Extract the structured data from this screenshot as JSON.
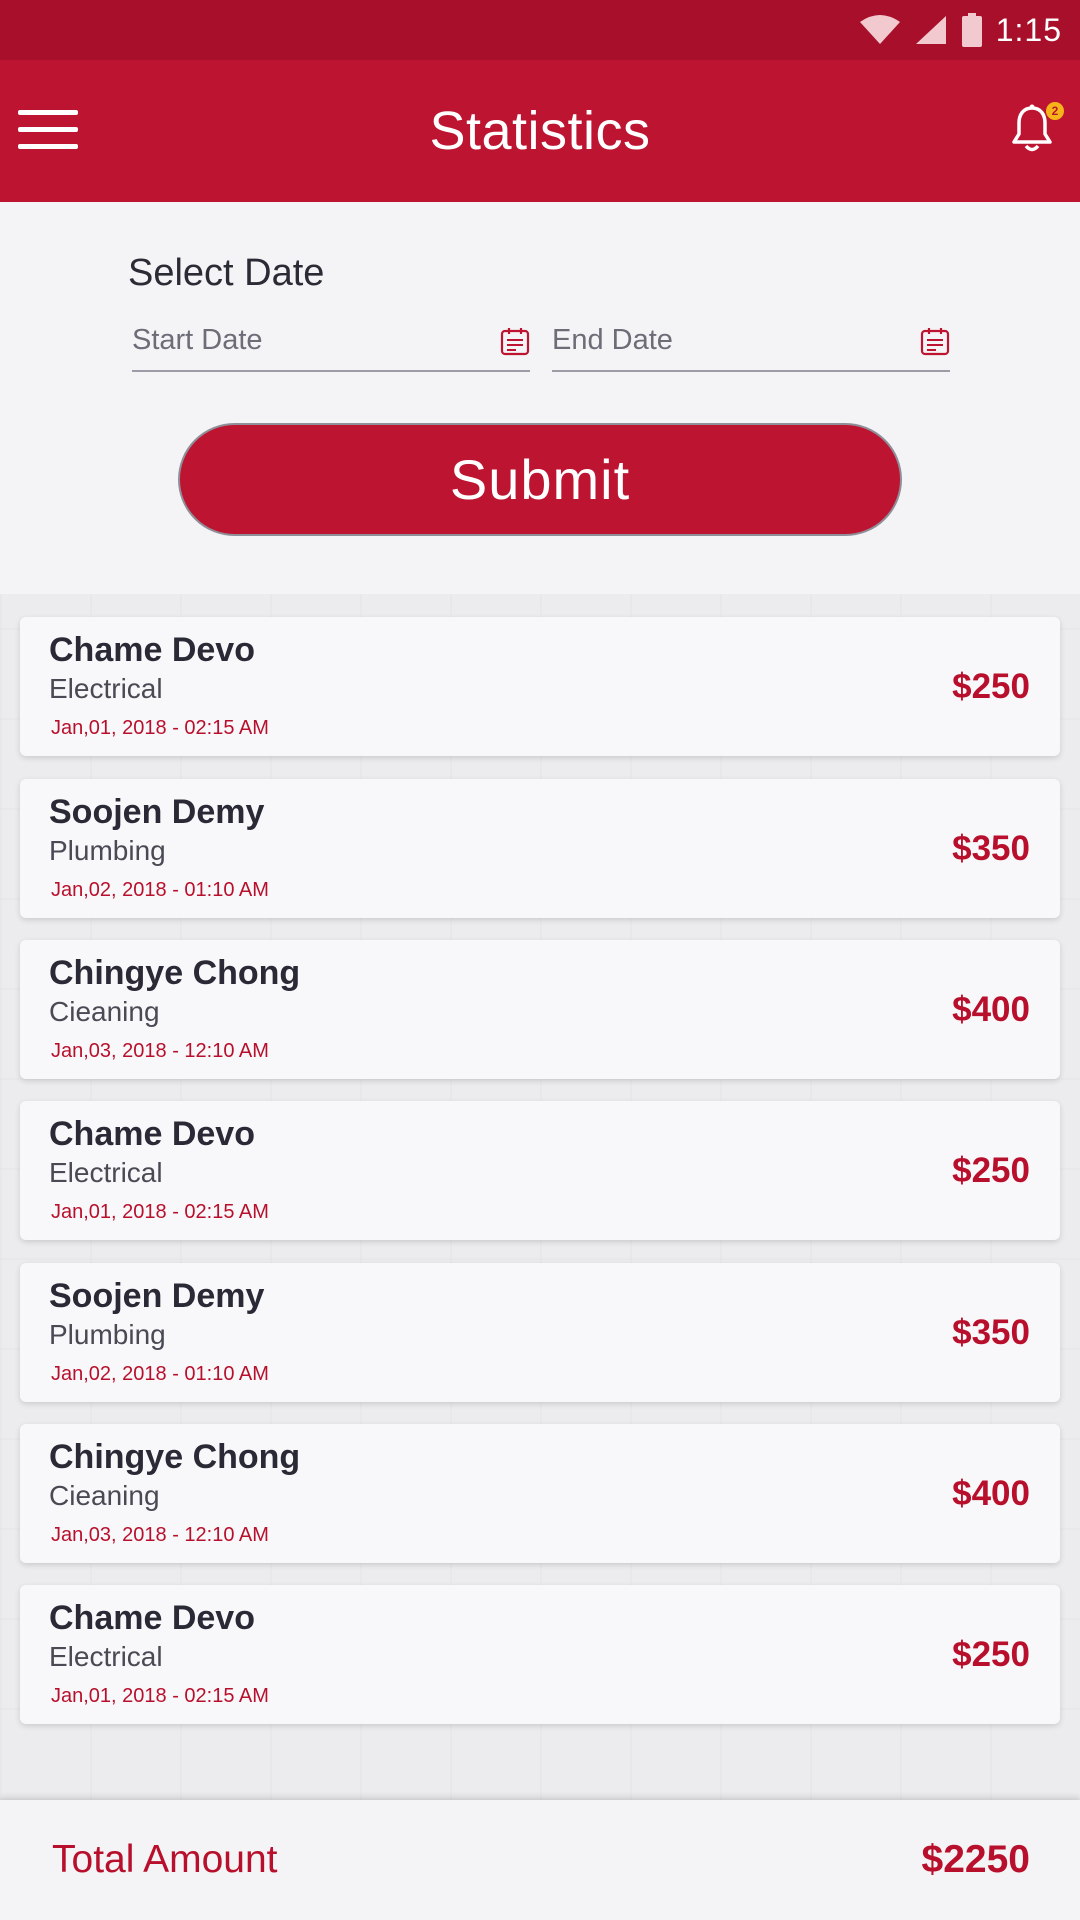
{
  "status_bar": {
    "time": "1:15",
    "icons": [
      "wifi-icon",
      "signal-icon",
      "battery-icon"
    ]
  },
  "app_bar": {
    "title": "Statistics",
    "menu_icon": "hamburger-menu-icon",
    "notification_icon": "bell-icon",
    "notification_count": "2"
  },
  "filter": {
    "title": "Select Date",
    "start_placeholder": "Start Date",
    "end_placeholder": "End Date",
    "calendar_icon": "calendar-icon",
    "submit_label": "Submit"
  },
  "transactions": [
    {
      "name": "Chame Devo",
      "service": "Electrical",
      "date": "Jan,01, 2018 - 02:15 AM",
      "amount": "$250"
    },
    {
      "name": "Soojen Demy",
      "service": "Plumbing",
      "date": "Jan,02, 2018 - 01:10 AM",
      "amount": "$350"
    },
    {
      "name": "Chingye Chong",
      "service": "Cieaning",
      "date": "Jan,03, 2018 - 12:10 AM",
      "amount": "$400"
    },
    {
      "name": "Chame Devo",
      "service": "Electrical",
      "date": "Jan,01, 2018 - 02:15 AM",
      "amount": "$250"
    },
    {
      "name": "Soojen Demy",
      "service": "Plumbing",
      "date": "Jan,02, 2018 - 01:10 AM",
      "amount": "$350"
    },
    {
      "name": "Chingye Chong",
      "service": "Cieaning",
      "date": "Jan,03, 2018 - 12:10 AM",
      "amount": "$400"
    },
    {
      "name": "Chame Devo",
      "service": "Electrical",
      "date": "Jan,01, 2018 - 02:15 AM",
      "amount": "$250"
    }
  ],
  "total": {
    "label": "Total Amount",
    "value": "$2250"
  },
  "colors": {
    "primary": "#bd1531",
    "primary_dark": "#a70f2a",
    "accent": "#f5b51a",
    "text_dark": "#2a2a36"
  }
}
